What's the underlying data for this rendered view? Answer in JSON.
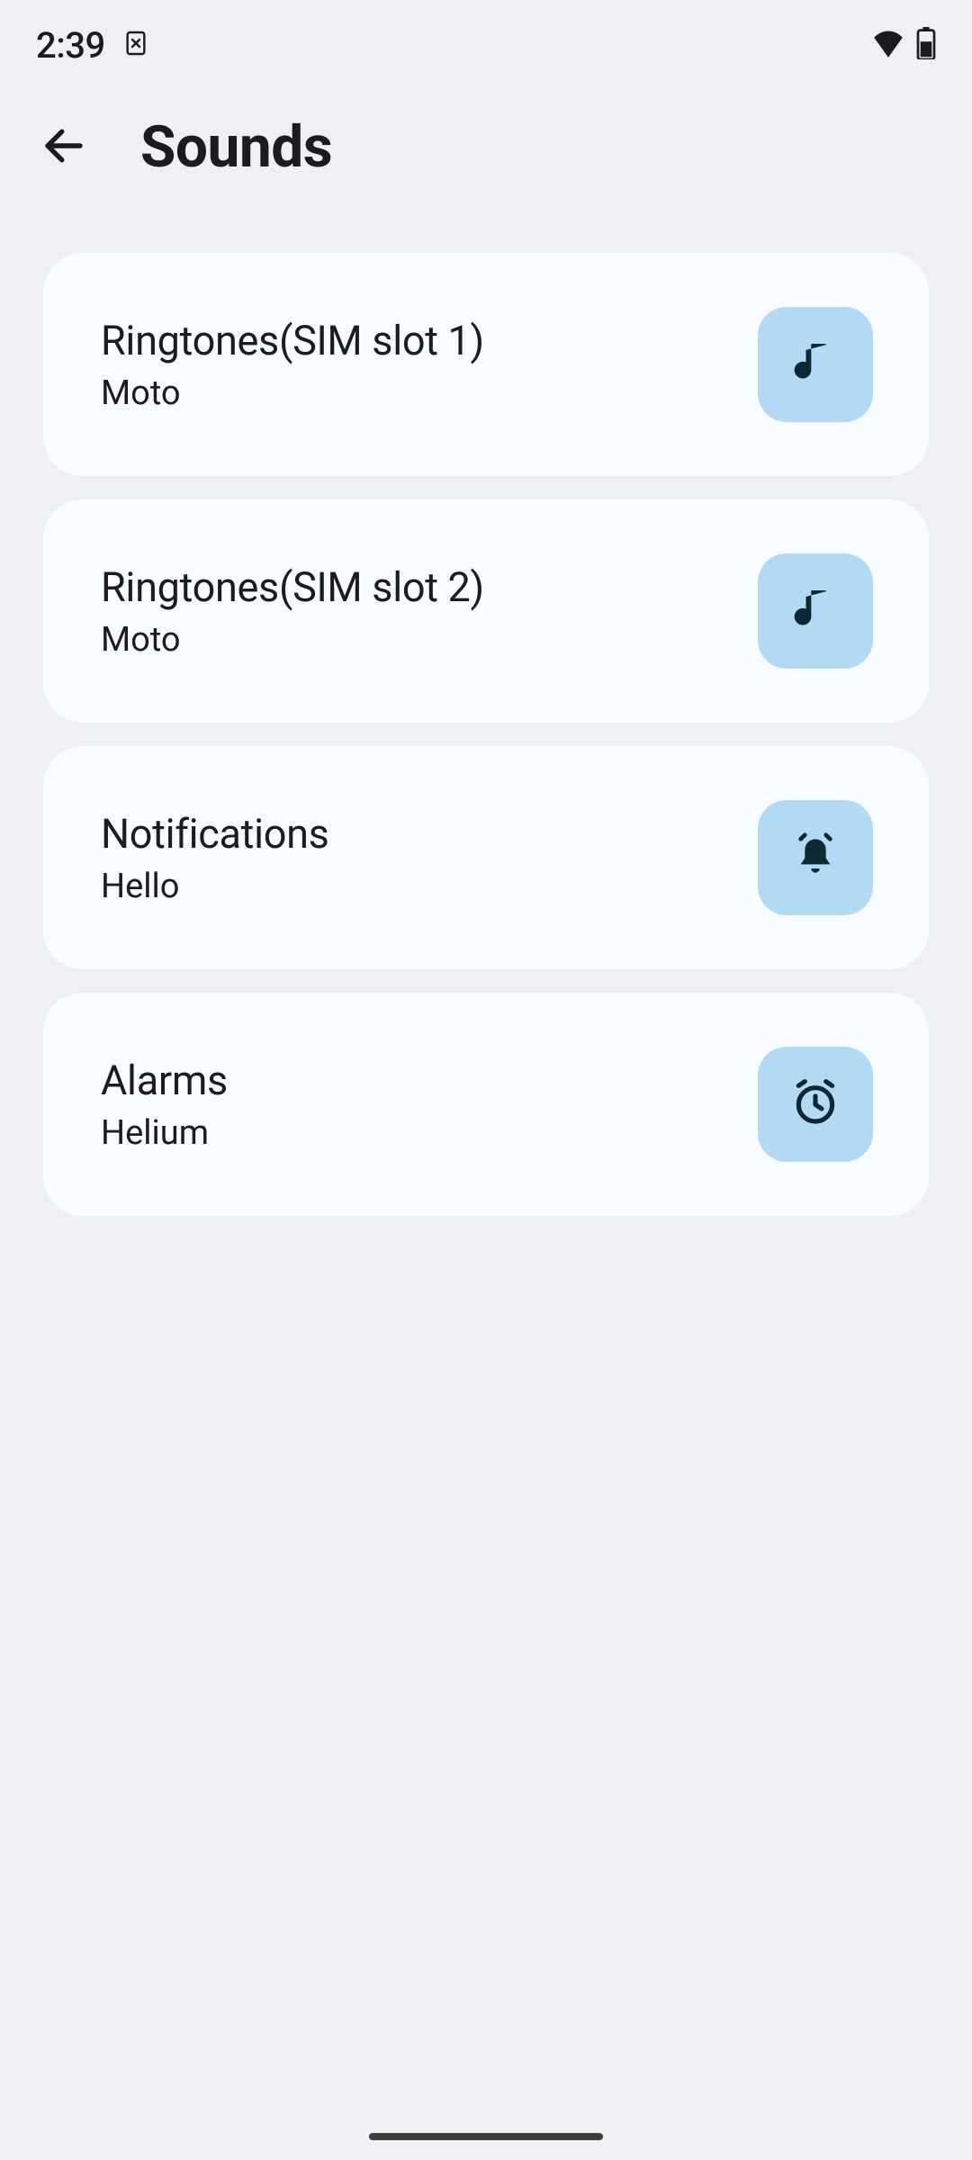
{
  "statusbar": {
    "time": "2:39"
  },
  "header": {
    "title": "Sounds"
  },
  "items": [
    {
      "title": "Ringtones(SIM slot 1)",
      "subtitle": "Moto",
      "icon": "music-note-icon"
    },
    {
      "title": "Ringtones(SIM slot 2)",
      "subtitle": "Moto",
      "icon": "music-note-icon"
    },
    {
      "title": "Notifications",
      "subtitle": "Hello",
      "icon": "bell-icon"
    },
    {
      "title": "Alarms",
      "subtitle": "Helium",
      "icon": "alarm-clock-icon"
    }
  ]
}
